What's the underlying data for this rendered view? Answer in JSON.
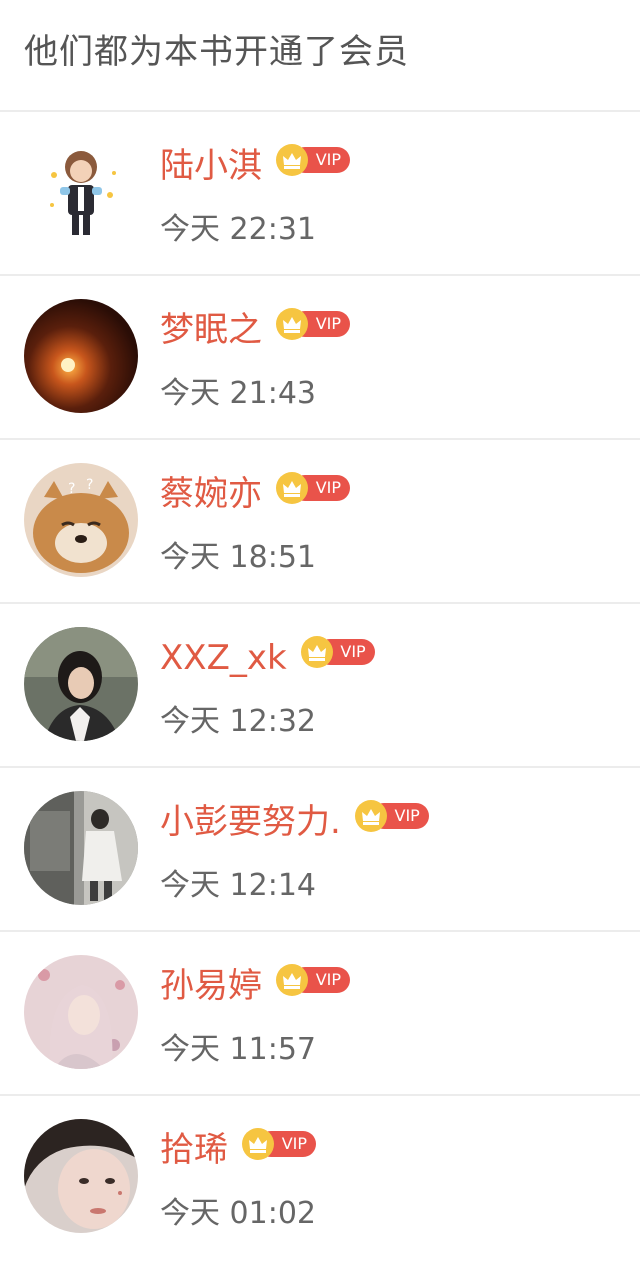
{
  "header": {
    "title": "他们都为本书开通了会员"
  },
  "badge": {
    "label": "VIP",
    "pill_color": "#e9534a",
    "crown_color": "#f6c541"
  },
  "members": [
    {
      "name": "陆小淇",
      "time": "今天 22:31",
      "avatar": "chibi-character-avatar"
    },
    {
      "name": "梦眠之",
      "time": "今天 21:43",
      "avatar": "night-light-avatar"
    },
    {
      "name": "蔡婉亦",
      "time": "今天 18:51",
      "avatar": "shiba-dog-avatar"
    },
    {
      "name": "XXZ_xk",
      "time": "今天 12:32",
      "avatar": "girl-portrait-avatar"
    },
    {
      "name": "小彭要努力.",
      "time": "今天 12:14",
      "avatar": "street-photo-avatar"
    },
    {
      "name": "孙易婷",
      "time": "今天 11:57",
      "avatar": "pink-hair-girl-avatar"
    },
    {
      "name": "拾琋",
      "time": "今天 01:02",
      "avatar": "selfie-girl-avatar"
    }
  ],
  "colors": {
    "name_text": "#e05a43",
    "time_text": "#666666",
    "header_text": "#555555",
    "divider": "#ececec"
  }
}
